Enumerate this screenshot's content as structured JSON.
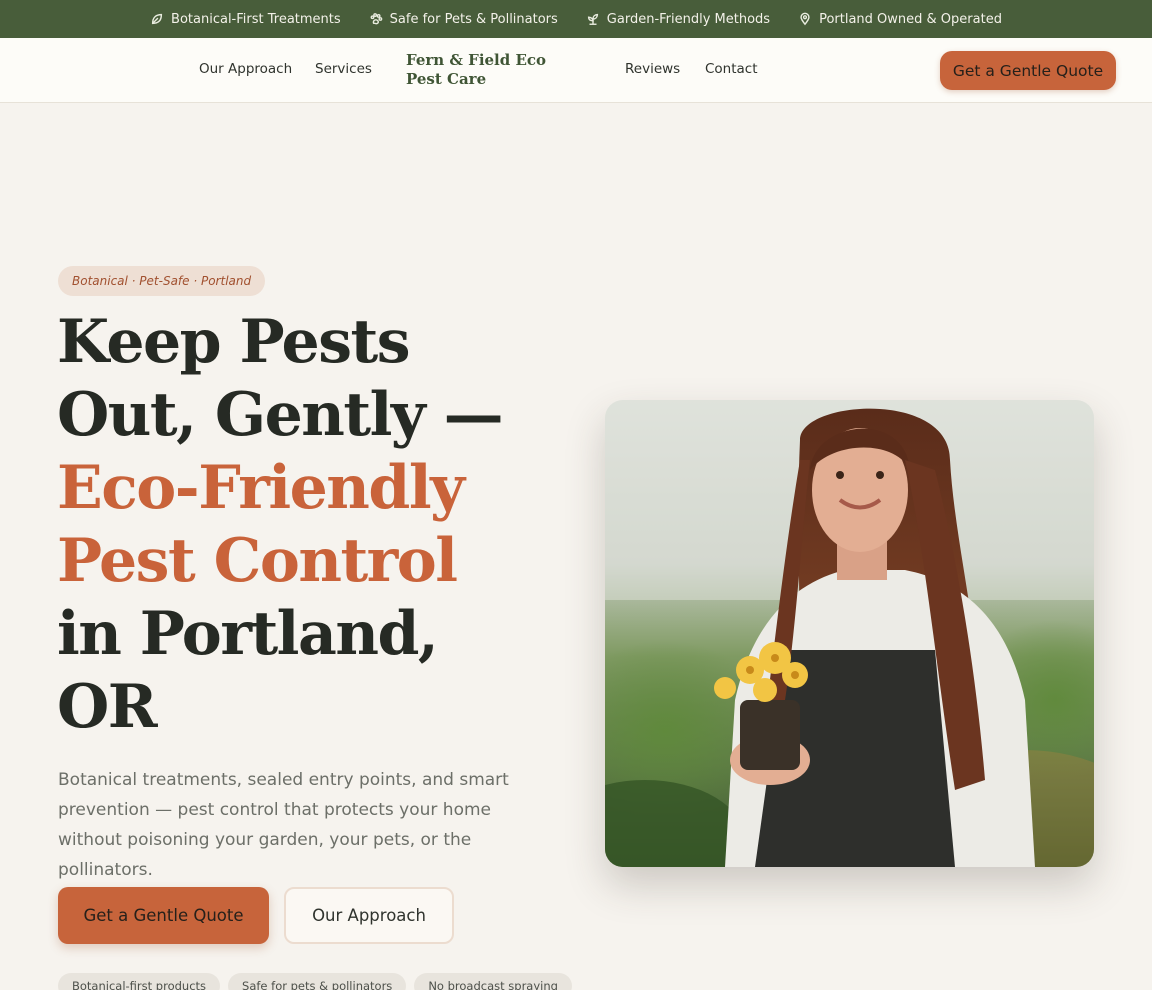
{
  "topbar": {
    "items": [
      {
        "label": "Botanical-First Treatments",
        "icon": "leaf-icon"
      },
      {
        "label": "Safe for Pets & Pollinators",
        "icon": "paw-icon"
      },
      {
        "label": "Garden-Friendly Methods",
        "icon": "sprout-icon"
      },
      {
        "label": "Portland Owned & Operated",
        "icon": "map-pin-icon"
      }
    ]
  },
  "header": {
    "nav": [
      "Our Approach",
      "Services",
      "Reviews",
      "Contact"
    ],
    "brand": "Fern & Field Eco Pest Care",
    "cta": "Get a Gentle Quote"
  },
  "hero": {
    "tag": "Botanical · Pet-Safe · Portland",
    "title_lines": [
      "Keep Pests",
      "Out, Gently —"
    ],
    "title_accent_lines": [
      "Eco-Friendly",
      "Pest Control"
    ],
    "title_end_lines": [
      "in Portland,",
      "OR"
    ],
    "subtitle": "Botanical treatments, sealed entry points, and smart prevention — pest control that protects your home without poisoning your garden, your pets, or the pollinators.",
    "primary_cta": "Get a Gentle Quote",
    "secondary_cta": "Our Approach",
    "pills": [
      "Botanical-first products",
      "Safe for pets & pollinators",
      "No broadcast spraying"
    ]
  },
  "colors": {
    "topbar_bg": "#485d3a",
    "accent": "#c7643b",
    "brand": "#3f5535",
    "background": "#f6f3ee"
  }
}
